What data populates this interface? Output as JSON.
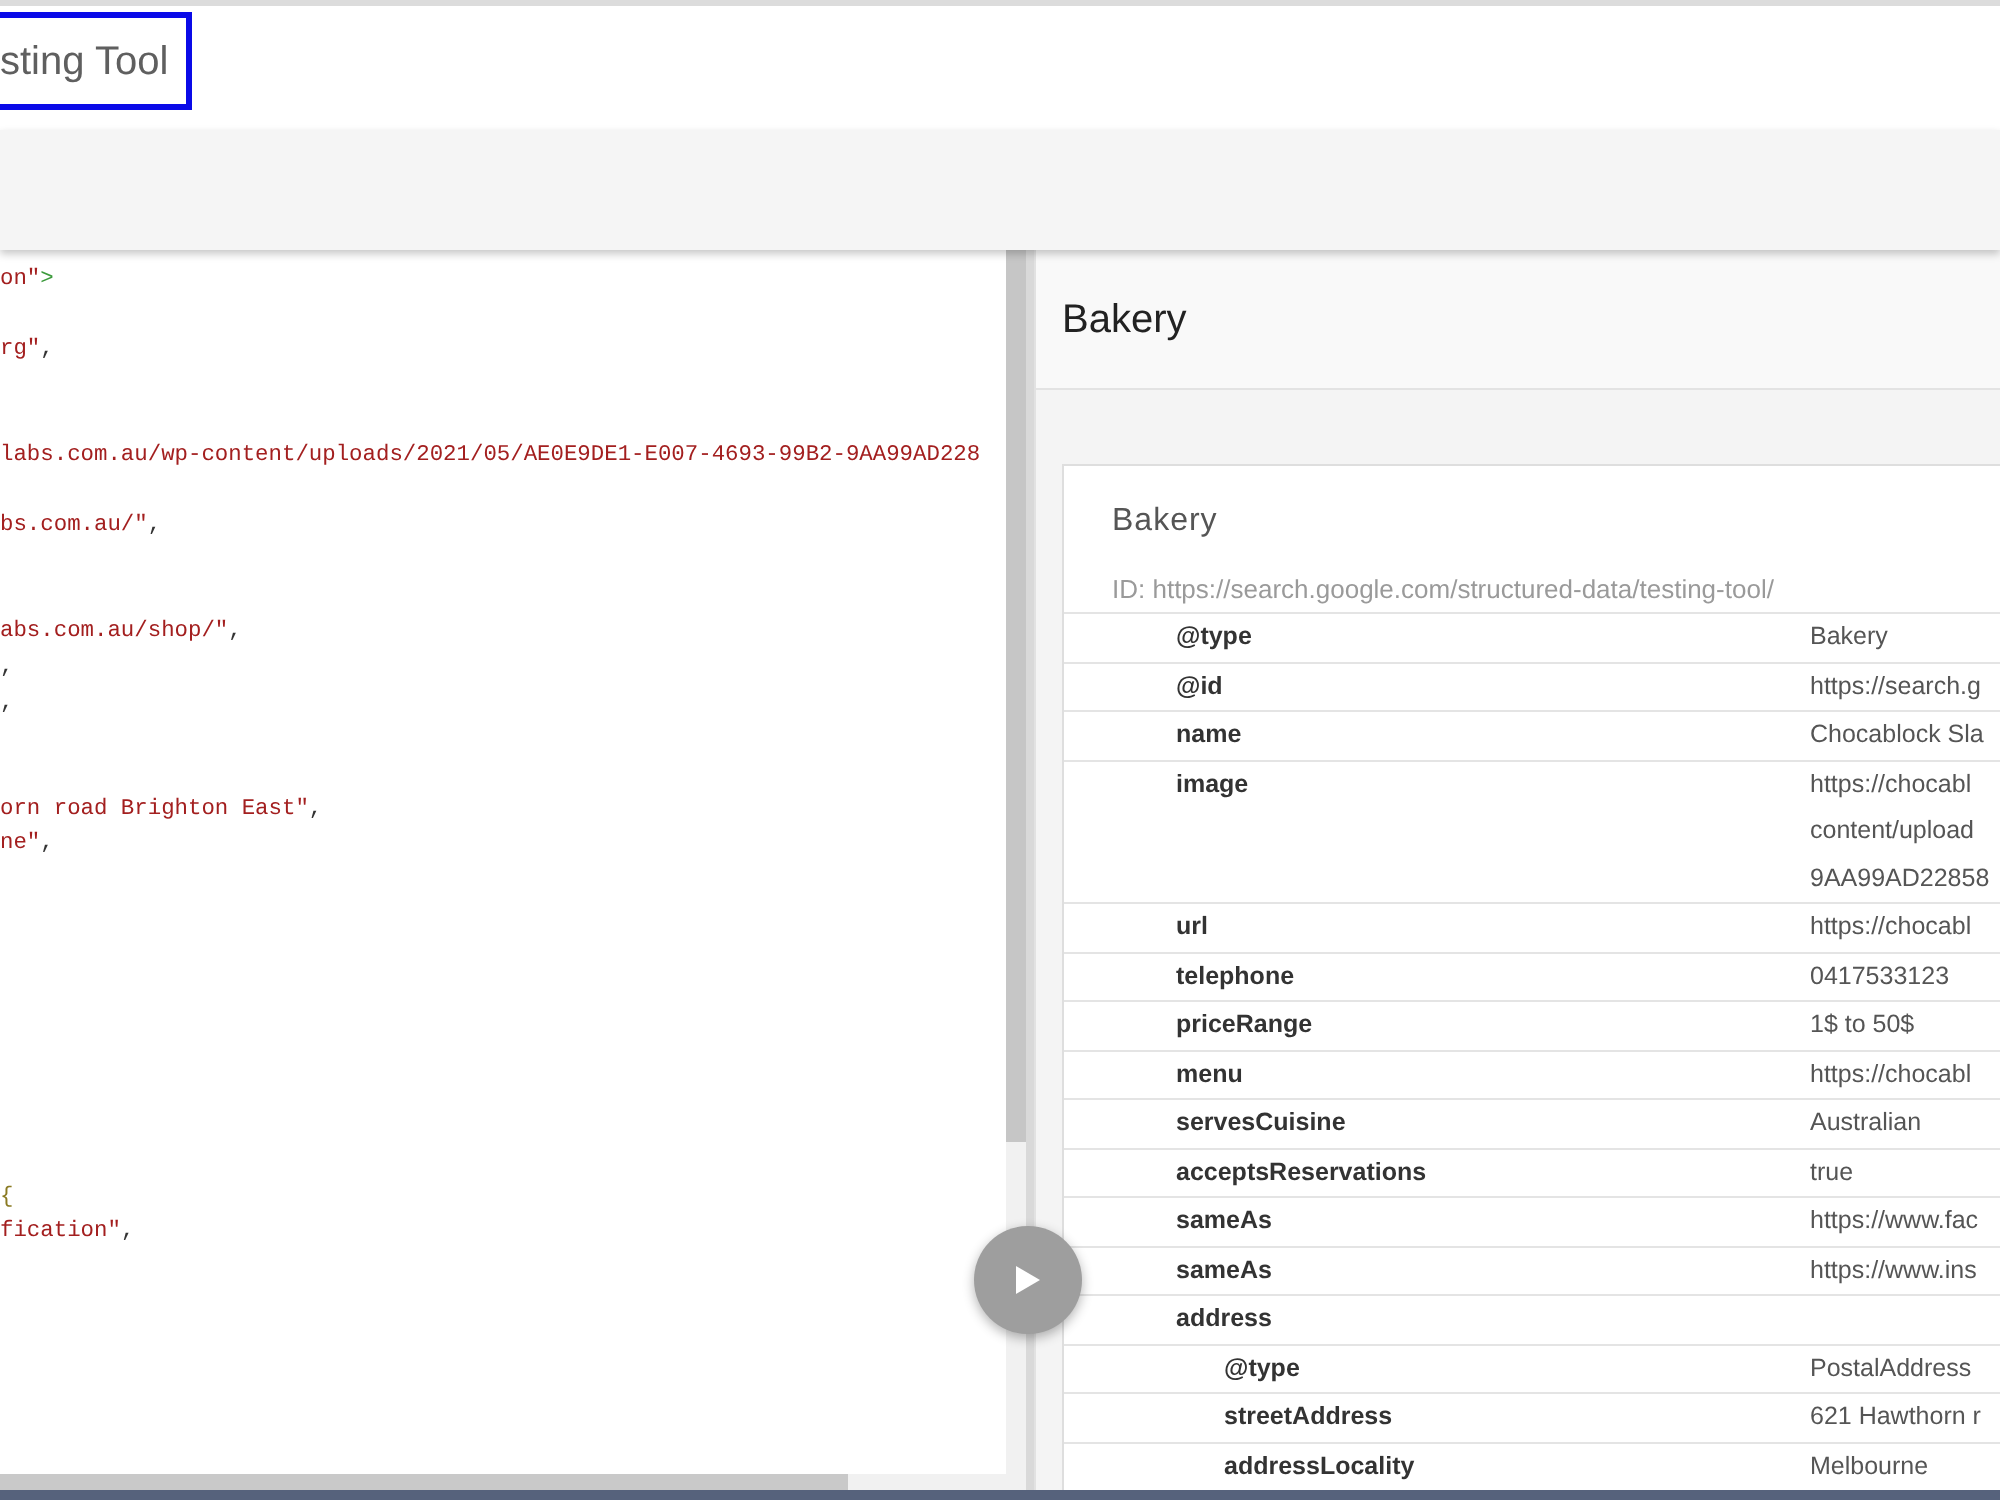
{
  "header": {
    "title": "sting Tool"
  },
  "editor": {
    "lines": [
      {
        "kind": "code",
        "tokens": [
          {
            "text": "on\"",
            "kind": "string"
          },
          {
            "text": ">",
            "kind": "tag"
          }
        ]
      },
      {
        "kind": "blank"
      },
      {
        "kind": "code",
        "tokens": [
          {
            "text": "rg\"",
            "kind": "string"
          },
          {
            "text": ",",
            "kind": "punct"
          }
        ]
      },
      {
        "kind": "blank"
      },
      {
        "kind": "blank"
      },
      {
        "kind": "code",
        "tokens": [
          {
            "text": "labs.com.au/wp-content/uploads/2021/05/AE0E9DE1-E007-4693-99B2-9AA99AD228",
            "kind": "string"
          }
        ]
      },
      {
        "kind": "blank"
      },
      {
        "kind": "code",
        "tokens": [
          {
            "text": "bs.com.au/\"",
            "kind": "string"
          },
          {
            "text": ",",
            "kind": "punct"
          }
        ]
      },
      {
        "kind": "blank"
      },
      {
        "kind": "blank"
      },
      {
        "kind": "code",
        "tokens": [
          {
            "text": "abs.com.au/shop/\"",
            "kind": "string"
          },
          {
            "text": ",",
            "kind": "punct"
          }
        ]
      },
      {
        "kind": "code",
        "tokens": [
          {
            "text": ",",
            "kind": "punct"
          }
        ]
      },
      {
        "kind": "code",
        "tokens": [
          {
            "text": ",",
            "kind": "punct"
          }
        ]
      },
      {
        "kind": "blank"
      },
      {
        "kind": "blank"
      },
      {
        "kind": "code",
        "tokens": [
          {
            "text": "orn road Brighton East\"",
            "kind": "string"
          },
          {
            "text": ",",
            "kind": "punct"
          }
        ]
      },
      {
        "kind": "code",
        "tokens": [
          {
            "text": "ne\"",
            "kind": "string"
          },
          {
            "text": ",",
            "kind": "punct"
          }
        ]
      },
      {
        "kind": "blank"
      },
      {
        "kind": "blank"
      },
      {
        "kind": "blank"
      },
      {
        "kind": "blank"
      },
      {
        "kind": "blank"
      },
      {
        "kind": "blank"
      },
      {
        "kind": "blank"
      },
      {
        "kind": "blank"
      },
      {
        "kind": "blank"
      },
      {
        "kind": "code",
        "tokens": [
          {
            "text": "{",
            "kind": "bracket"
          }
        ]
      },
      {
        "kind": "code",
        "tokens": [
          {
            "text": "fication\"",
            "kind": "string"
          },
          {
            "text": ",",
            "kind": "punct"
          }
        ]
      }
    ]
  },
  "result": {
    "title": "Bakery",
    "item": {
      "type_name": "Bakery",
      "id_line": "ID: https://search.google.com/structured-data/testing-tool/",
      "properties": [
        {
          "name": "@type",
          "value": "Bakery"
        },
        {
          "name": "@id",
          "value": "https://search.g"
        },
        {
          "name": "name",
          "value": "Chocablock Sla"
        },
        {
          "name": "image",
          "value": "https://chocabl\ncontent/upload\n9AA99AD22858"
        },
        {
          "name": "url",
          "value": "https://chocabl"
        },
        {
          "name": "telephone",
          "value": "0417533123"
        },
        {
          "name": "priceRange",
          "value": "1$ to 50$"
        },
        {
          "name": "menu",
          "value": "https://chocabl"
        },
        {
          "name": "servesCuisine",
          "value": "Australian"
        },
        {
          "name": "acceptsReservations",
          "value": "true"
        },
        {
          "name": "sameAs",
          "value": "https://www.fac"
        },
        {
          "name": "sameAs",
          "value": "https://www.ins"
        },
        {
          "name": "address",
          "children": [
            {
              "name": "@type",
              "value": "PostalAddress"
            },
            {
              "name": "streetAddress",
              "value": "621 Hawthorn r"
            },
            {
              "name": "addressLocality",
              "value": "Melbourne"
            }
          ]
        }
      ]
    }
  }
}
